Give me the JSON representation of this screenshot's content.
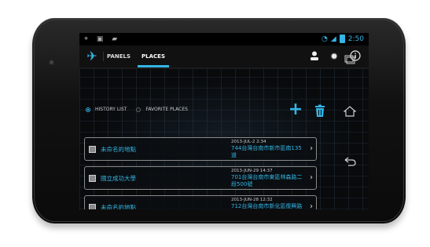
{
  "status_bar": {
    "left_icons": [
      "crosshair-icon",
      "image-icon",
      "controller-icon"
    ],
    "time": "2:50"
  },
  "action_bar": {
    "tabs": [
      {
        "label": "PANELS"
      },
      {
        "label": "PLACES",
        "selected": true
      }
    ],
    "icons": [
      "person-icon",
      "gear-icon",
      "info-icon"
    ]
  },
  "places": {
    "filter_options": [
      {
        "label": "HISTORY LIST",
        "selected": true
      },
      {
        "label": "FAVORITE PLACES",
        "selected": false
      }
    ],
    "rows": [
      {
        "name": "未命名的地點",
        "date": "2013-JUL-2 2:34",
        "address": "744台灣台南市新市區南135道"
      },
      {
        "name": "國立成功大學",
        "date": "2013-JUN-29 14:37",
        "address": "701台灣台南市東區林森路二段500號"
      },
      {
        "name": "未命名的地點",
        "date": "2013-JUN-28 12:32",
        "address": "712台灣台南市新化區復興路1-23號"
      }
    ]
  },
  "colors": {
    "accent": "#33b5e5",
    "background": "#080a0c"
  }
}
